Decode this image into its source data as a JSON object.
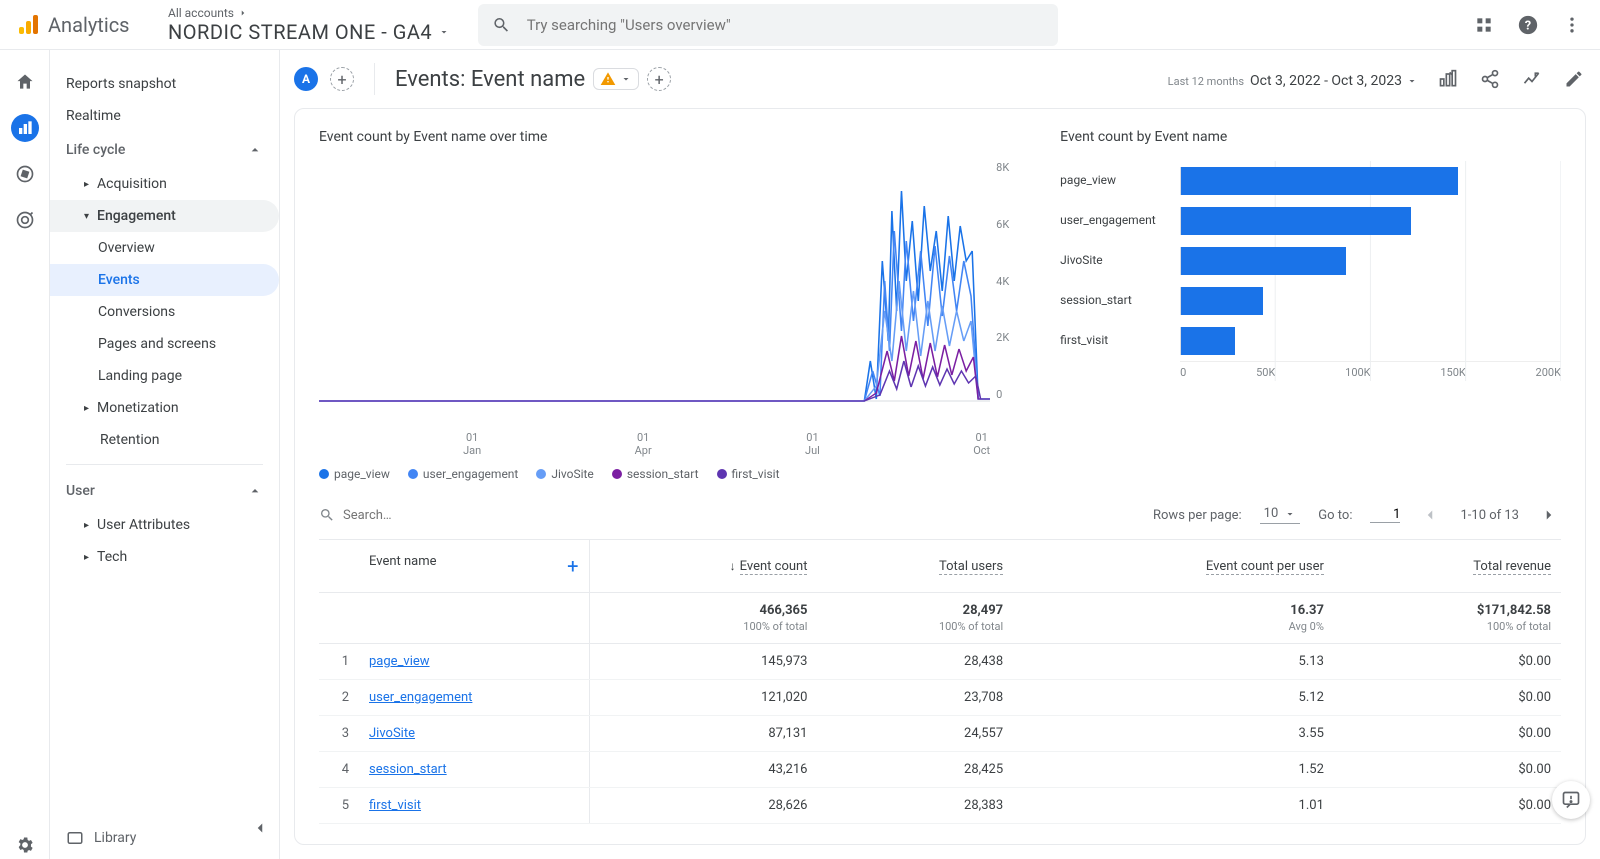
{
  "header": {
    "product": "Analytics",
    "account_label": "All accounts",
    "property": "NORDIC STREAM ONE - GA4",
    "search_placeholder": "Try searching \"Users overview\""
  },
  "nav": {
    "snapshot": "Reports snapshot",
    "realtime": "Realtime",
    "lifecycle": "Life cycle",
    "acquisition": "Acquisition",
    "engagement": "Engagement",
    "overview": "Overview",
    "events": "Events",
    "conversions": "Conversions",
    "pages": "Pages and screens",
    "landing": "Landing page",
    "monetization": "Monetization",
    "retention": "Retention",
    "user": "User",
    "user_attr": "User Attributes",
    "tech": "Tech",
    "library": "Library"
  },
  "toolbar": {
    "segment_badge": "A",
    "title": "Events: Event name",
    "dr_label": "Last 12 months",
    "date_range": "Oct 3, 2022 - Oct 3, 2023"
  },
  "chart_time": {
    "title": "Event count by Event name over time",
    "y_ticks": [
      "8K",
      "6K",
      "4K",
      "2K",
      "0"
    ],
    "x_ticks": [
      {
        "num": "01",
        "mon": "Jan"
      },
      {
        "num": "01",
        "mon": "Apr"
      },
      {
        "num": "01",
        "mon": "Jul"
      },
      {
        "num": "01",
        "mon": "Oct"
      }
    ],
    "legend": [
      "page_view",
      "user_engagement",
      "JivoSite",
      "session_start",
      "first_visit"
    ]
  },
  "chart_bar": {
    "title": "Event count by Event name",
    "x_ticks": [
      "0",
      "50K",
      "100K",
      "150K",
      "200K"
    ]
  },
  "chart_data": {
    "type": "bar",
    "title": "Event count by Event name",
    "xlabel": "",
    "ylabel": "",
    "xlim": [
      0,
      200000
    ],
    "categories": [
      "page_view",
      "user_engagement",
      "JivoSite",
      "session_start",
      "first_visit"
    ],
    "values": [
      145973,
      121020,
      87131,
      43216,
      28626
    ]
  },
  "table_ctrl": {
    "search_placeholder": "Search…",
    "rpp_label": "Rows per page:",
    "rpp_value": "10",
    "goto_label": "Go to:",
    "goto_value": "1",
    "range": "1-10 of 13"
  },
  "table": {
    "headers": {
      "dim": "Event name",
      "c1": "Event count",
      "c2": "Total users",
      "c3": "Event count per user",
      "c4": "Total revenue"
    },
    "totals": {
      "c1": "466,365",
      "c1s": "100% of total",
      "c2": "28,497",
      "c2s": "100% of total",
      "c3": "16.37",
      "c3s": "Avg 0%",
      "c4": "$171,842.58",
      "c4s": "100% of total"
    },
    "rows": [
      {
        "i": "1",
        "n": "page_view",
        "c1": "145,973",
        "c2": "28,438",
        "c3": "5.13",
        "c4": "$0.00"
      },
      {
        "i": "2",
        "n": "user_engagement",
        "c1": "121,020",
        "c2": "23,708",
        "c3": "5.12",
        "c4": "$0.00"
      },
      {
        "i": "3",
        "n": "JivoSite",
        "c1": "87,131",
        "c2": "24,557",
        "c3": "3.55",
        "c4": "$0.00"
      },
      {
        "i": "4",
        "n": "session_start",
        "c1": "43,216",
        "c2": "28,425",
        "c3": "1.52",
        "c4": "$0.00"
      },
      {
        "i": "5",
        "n": "first_visit",
        "c1": "28,626",
        "c2": "28,383",
        "c3": "1.01",
        "c4": "$0.00"
      }
    ]
  }
}
